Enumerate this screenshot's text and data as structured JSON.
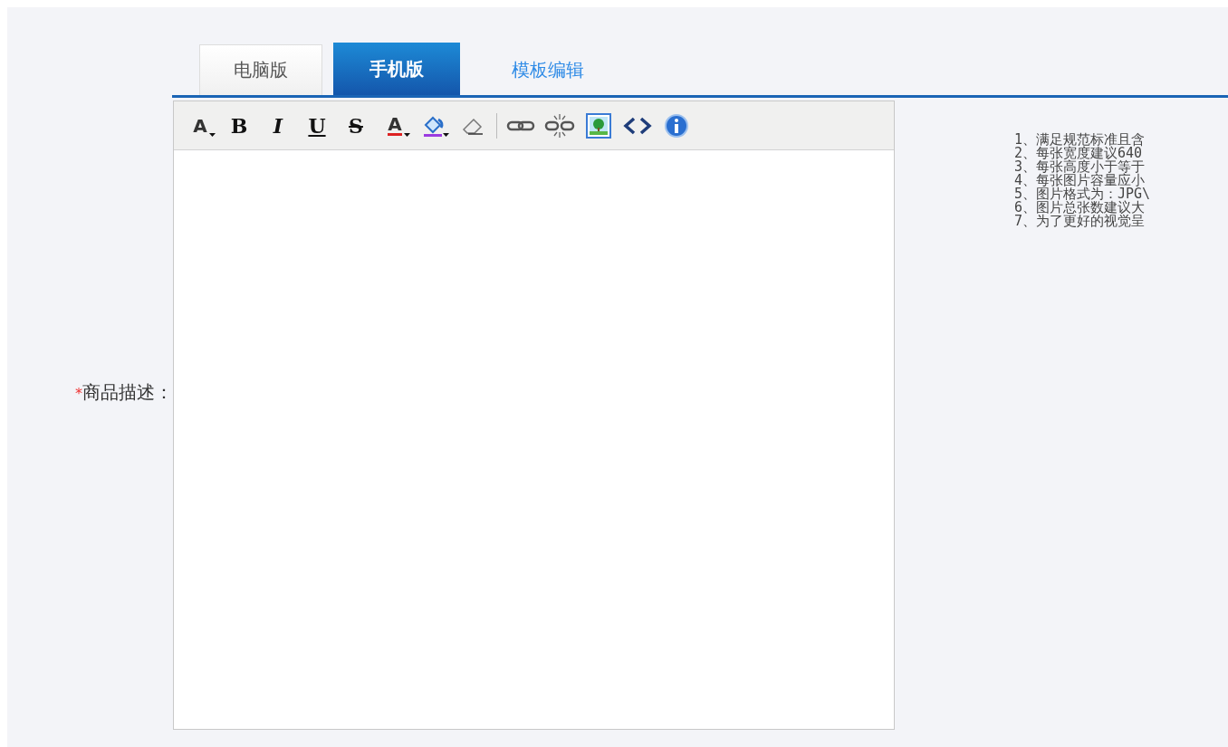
{
  "tabs": [
    {
      "label": "电脑版",
      "selected": false,
      "kind": "tab"
    },
    {
      "label": "手机版",
      "selected": true,
      "kind": "tab"
    },
    {
      "label": "模板编辑",
      "selected": false,
      "kind": "link"
    }
  ],
  "field": {
    "required_mark": "*",
    "label": "商品描述："
  },
  "toolbar": [
    {
      "kind": "fontsize",
      "glyph": "A"
    },
    {
      "kind": "bold",
      "glyph": "B"
    },
    {
      "kind": "italic",
      "glyph": "I"
    },
    {
      "kind": "underline",
      "glyph": "U"
    },
    {
      "kind": "strike",
      "glyph": "S"
    },
    {
      "kind": "forecolor",
      "glyph": "A"
    },
    {
      "kind": "backcolor"
    },
    {
      "kind": "eraser"
    },
    {
      "kind": "separator"
    },
    {
      "kind": "link"
    },
    {
      "kind": "unlink"
    },
    {
      "kind": "image"
    },
    {
      "kind": "source"
    },
    {
      "kind": "info"
    }
  ],
  "tips": [
    "1、满足规范标准且含",
    "2、每张宽度建议640",
    "3、每张高度小于等于",
    "4、每张图片容量应小",
    "5、图片格式为：JPG\\",
    "6、图片总张数建议大",
    "7、为了更好的视觉呈"
  ]
}
